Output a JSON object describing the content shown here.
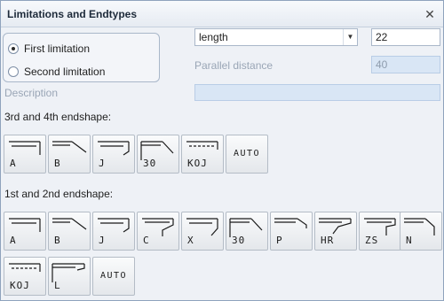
{
  "window": {
    "title": "Limitations and Endtypes"
  },
  "limitation": {
    "options": [
      "First limitation",
      "Second limitation"
    ],
    "selected": 0
  },
  "type_select": {
    "value": "length"
  },
  "length_value": "22",
  "parallel": {
    "label": "Parallel distance",
    "value": "40"
  },
  "description": {
    "label": "Description",
    "value": ""
  },
  "sections": {
    "third_fourth": {
      "label": "3rd and 4th endshape:",
      "buttons": [
        "A",
        "B",
        "J",
        "30",
        "KOJ",
        "AUTO"
      ]
    },
    "first_second": {
      "label": "1st and 2nd endshape:",
      "buttons": [
        "A",
        "B",
        "J",
        "C",
        "X",
        "30",
        "P",
        "HR",
        "ZS",
        "N",
        "KOJ",
        "L",
        "AUTO"
      ]
    }
  }
}
